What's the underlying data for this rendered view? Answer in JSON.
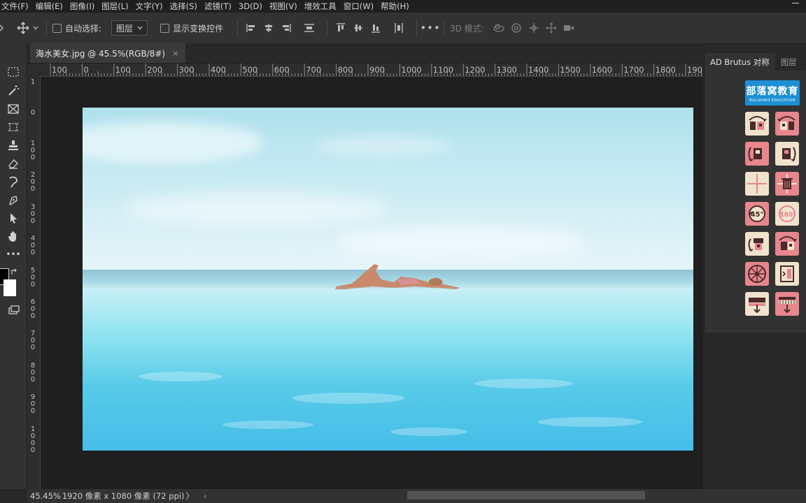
{
  "menu": [
    "文件(F)",
    "编辑(E)",
    "图像(I)",
    "图层(L)",
    "文字(Y)",
    "选择(S)",
    "滤镜(T)",
    "3D(D)",
    "视图(V)",
    "增效工具",
    "窗口(W)",
    "帮助(H)"
  ],
  "options": {
    "auto_select_label": "自动选择:",
    "layer_dropdown": "图层",
    "show_transform_label": "显示变换控件",
    "three_d_mode_label": "3D 模式:"
  },
  "document": {
    "tab_title": "海水美女.jpg @ 45.5%(RGB/8#)",
    "close_symbol": "×"
  },
  "ruler_top_labels": [
    "100",
    "0",
    "100",
    "200",
    "300",
    "400",
    "500",
    "600",
    "700",
    "800",
    "900",
    "1000",
    "1100",
    "1200",
    "1300",
    "1400",
    "1500",
    "1600",
    "1700",
    "1800",
    "190"
  ],
  "ruler_left_labels": [
    "1",
    "0",
    "1 0 0",
    "2 0 0",
    "3 0 0",
    "4 0 0",
    "5 0 0",
    "6 0 0",
    "7 0 0",
    "8 0 0",
    "9 0 0",
    "1 0 0 0"
  ],
  "status": {
    "zoom": "45.45%",
    "doc_info": "1920 像素 x 1080 像素 (72 ppi)",
    "nav_right": "〉",
    "nav_left": "‹"
  },
  "panel": {
    "tab_active": "AD Brutus 对称",
    "tab_layers": "图层",
    "brand_title": "部落窝教育",
    "brand_sub": "BULUOWO EDUCATION"
  },
  "colors": {
    "pink_button": "#e7868d",
    "cream_button": "#efe3cc",
    "brand_blue": "#1d8fd4"
  }
}
